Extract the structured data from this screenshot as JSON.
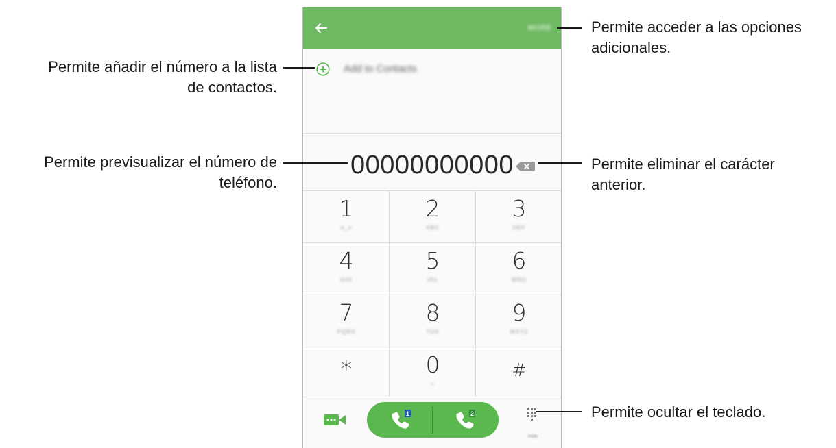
{
  "colors": {
    "accent_green": "#6fb962",
    "call_green": "#5ab84f",
    "sim_badge_blue": "#1f5fa8",
    "sim_badge_green": "#2e8b3a"
  },
  "app_bar": {
    "back_icon": "arrow-left-icon",
    "more_label": "MORE"
  },
  "add_contacts": {
    "icon": "plus-circle-icon",
    "label": "Add to Contacts"
  },
  "number_display": {
    "value": "00000000000",
    "backspace_icon": "backspace-icon"
  },
  "keypad": {
    "keys": [
      {
        "digit": "1",
        "letters": ""
      },
      {
        "digit": "2",
        "letters": "ABC"
      },
      {
        "digit": "3",
        "letters": "DEF"
      },
      {
        "digit": "4",
        "letters": "GHI"
      },
      {
        "digit": "5",
        "letters": "JKL"
      },
      {
        "digit": "6",
        "letters": "MNO"
      },
      {
        "digit": "7",
        "letters": "PQRS"
      },
      {
        "digit": "8",
        "letters": "TUV"
      },
      {
        "digit": "9",
        "letters": "WXYZ"
      },
      {
        "digit": "*",
        "letters": ""
      },
      {
        "digit": "0",
        "letters": "+"
      },
      {
        "digit": "#",
        "letters": ""
      }
    ]
  },
  "bottom_bar": {
    "video_icon": "video-call-icon",
    "call_sim1": {
      "icon": "phone-icon",
      "badge": "1"
    },
    "call_sim2": {
      "icon": "phone-icon",
      "badge": "2"
    },
    "hide_icon": "dialpad-icon",
    "hide_label": "Hide"
  },
  "annotations": {
    "more": {
      "line1": "Permite acceder a las opciones",
      "line2": "adicionales."
    },
    "add": {
      "line1": "Permite añadir el número a la lista",
      "line2": "de contactos."
    },
    "preview": {
      "line1": "Permite previsualizar el número de",
      "line2": "teléfono."
    },
    "delete": {
      "line1": "Permite eliminar el carácter",
      "line2": "anterior."
    },
    "hide": {
      "line1": "Permite ocultar el teclado."
    }
  }
}
